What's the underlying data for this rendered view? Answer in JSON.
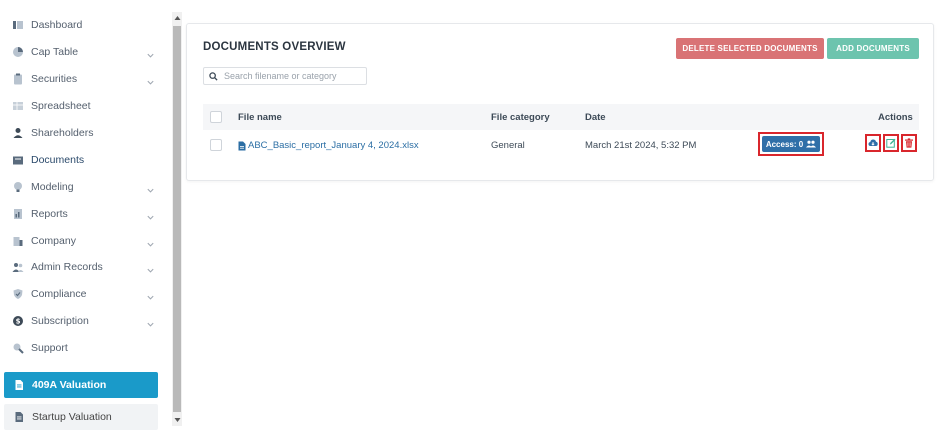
{
  "sidebar": {
    "items": [
      {
        "label": "Dashboard",
        "icon": "dashboard-icon"
      },
      {
        "label": "Cap Table",
        "icon": "pie-chart-icon"
      },
      {
        "label": "Securities",
        "icon": "clipboard-icon"
      },
      {
        "label": "Spreadsheet",
        "icon": "spreadsheet-icon"
      },
      {
        "label": "Shareholders",
        "icon": "user-icon"
      },
      {
        "label": "Documents",
        "icon": "documents-icon"
      },
      {
        "label": "Modeling",
        "icon": "lightbulb-icon"
      },
      {
        "label": "Reports",
        "icon": "report-icon"
      },
      {
        "label": "Company",
        "icon": "building-icon"
      },
      {
        "label": "Admin Records",
        "icon": "admin-icon"
      },
      {
        "label": "Compliance",
        "icon": "shield-icon"
      },
      {
        "label": "Subscription",
        "icon": "dollar-icon"
      },
      {
        "label": "Support",
        "icon": "support-icon"
      }
    ],
    "valuation_label": "409A Valuation",
    "startup_label": "Startup Valuation"
  },
  "main": {
    "title": "DOCUMENTS OVERVIEW",
    "delete_label": "DELETE SELECTED DOCUMENTS",
    "add_label": "ADD DOCUMENTS",
    "search_placeholder": "Search filename or category",
    "columns": {
      "file_name": "File name",
      "category": "File category",
      "date": "Date",
      "actions": "Actions"
    },
    "rows": [
      {
        "file_name": "ABC_Basic_report_January 4, 2024.xlsx",
        "category": "General",
        "date": "March 21st 2024, 5:32 PM",
        "access_label": "Access: 0"
      }
    ]
  },
  "colors": {
    "accent": "#1a9ac9",
    "delete": "#d97375",
    "add": "#6dc4ae",
    "access": "#2f6fa8",
    "highlight": "#d9262c"
  }
}
